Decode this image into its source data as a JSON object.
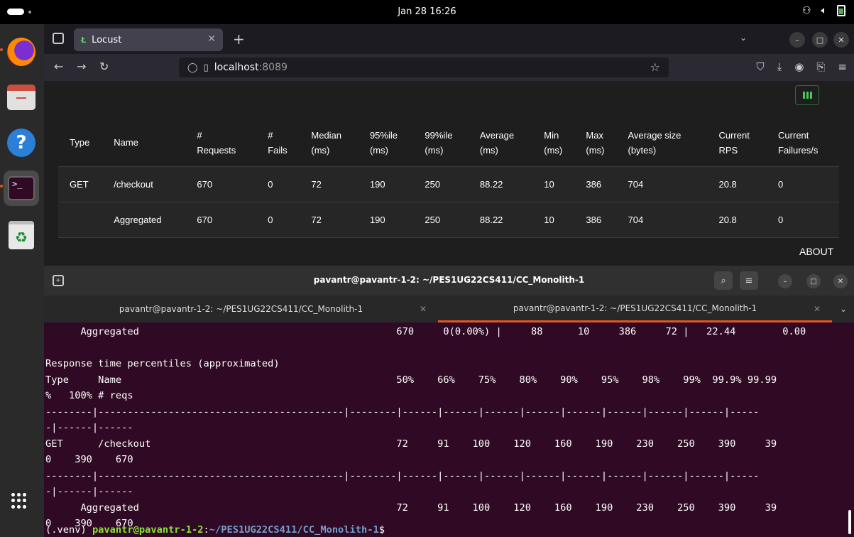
{
  "topbar": {
    "clock": "Jan 28  16:26"
  },
  "browser": {
    "tab_title": "Locust",
    "tab_favicon": "Ł",
    "url_host": "localhost",
    "url_port": ":8089",
    "table": {
      "headers": [
        [
          "Type"
        ],
        [
          "Name"
        ],
        [
          "#",
          "Requests"
        ],
        [
          "#",
          "Fails"
        ],
        [
          "Median",
          "(ms)"
        ],
        [
          "95%ile",
          "(ms)"
        ],
        [
          "99%ile",
          "(ms)"
        ],
        [
          "Average",
          "(ms)"
        ],
        [
          "Min",
          "(ms)"
        ],
        [
          "Max",
          "(ms)"
        ],
        [
          "Average size",
          "(bytes)"
        ],
        [
          "Current",
          "RPS"
        ],
        [
          "Current",
          "Failures/s"
        ]
      ],
      "rows": [
        [
          "GET",
          "/checkout",
          "670",
          "0",
          "72",
          "190",
          "250",
          "88.22",
          "10",
          "386",
          "704",
          "20.8",
          "0"
        ],
        [
          "",
          "Aggregated",
          "670",
          "0",
          "72",
          "190",
          "250",
          "88.22",
          "10",
          "386",
          "704",
          "20.8",
          "0"
        ]
      ]
    },
    "about_label": "ABOUT"
  },
  "terminal": {
    "title": "pavantr@pavantr-1-2: ~/PES1UG22CS411/CC_Monolith-1",
    "tabs": [
      "pavantr@pavantr-1-2: ~/PES1UG22CS411/CC_Monolith-1",
      "pavantr@pavantr-1-2: ~/PES1UG22CS411/CC_Monolith-1"
    ],
    "output": "      Aggregated                                            670     0(0.00%) |     88      10     386     72 |   22.44        0.00\n\nResponse time percentiles (approximated)\nType     Name                                               50%    66%    75%    80%    90%    95%    98%    99%  99.9% 99.99\n%   100% # reqs\n--------|------------------------------------------|--------|------|------|------|------|------|------|------|------|-----\n-|------|------\nGET      /checkout                                          72     91    100    120    160    190    230    250    390     39\n0    390    670\n--------|------------------------------------------|--------|------|------|------|------|------|------|------|------|-----\n-|------|------\n      Aggregated                                            72     91    100    120    160    190    230    250    390     39\n0    390    670",
    "prompt_venv": "(.venv) ",
    "prompt_user": "pavantr@pavantr-1-2",
    "prompt_sep": ":",
    "prompt_path": "~/PES1UG22CS411/CC_Monolith-1",
    "prompt_end": "$"
  }
}
